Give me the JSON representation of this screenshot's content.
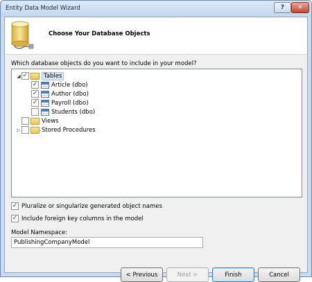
{
  "window": {
    "title": "Entity Data Model Wizard",
    "help_label": "?",
    "close_label": "✕"
  },
  "header": {
    "icon": "database-icon",
    "title": "Choose Your Database Objects"
  },
  "prompt": "Which database objects do you want to include in your model?",
  "tree": {
    "tables": {
      "label": "Tables",
      "expanded": true,
      "checked": true,
      "items": [
        {
          "label": "Article (dbo)",
          "checked": true
        },
        {
          "label": "Author (dbo)",
          "checked": true
        },
        {
          "label": "Payroll (dbo)",
          "checked": true
        },
        {
          "label": "Students (dbo)",
          "checked": false
        }
      ]
    },
    "views": {
      "label": "Views",
      "checked": false
    },
    "procedures": {
      "label": "Stored Procedures",
      "checked": false
    }
  },
  "options": {
    "pluralize": {
      "label": "Pluralize or singularize generated object names",
      "checked": true
    },
    "foreign_keys": {
      "label": "Include foreign key columns in the model",
      "checked": true
    }
  },
  "namespace": {
    "label": "Model Namespace:",
    "value": "PublishingCompanyModel"
  },
  "buttons": {
    "previous": "< Previous",
    "next": "Next >",
    "finish": "Finish",
    "cancel": "Cancel"
  },
  "colors": {
    "title_bar": "#c3d7ee",
    "client_bg": "#f0f0f0",
    "close_button": "#c4472f"
  }
}
